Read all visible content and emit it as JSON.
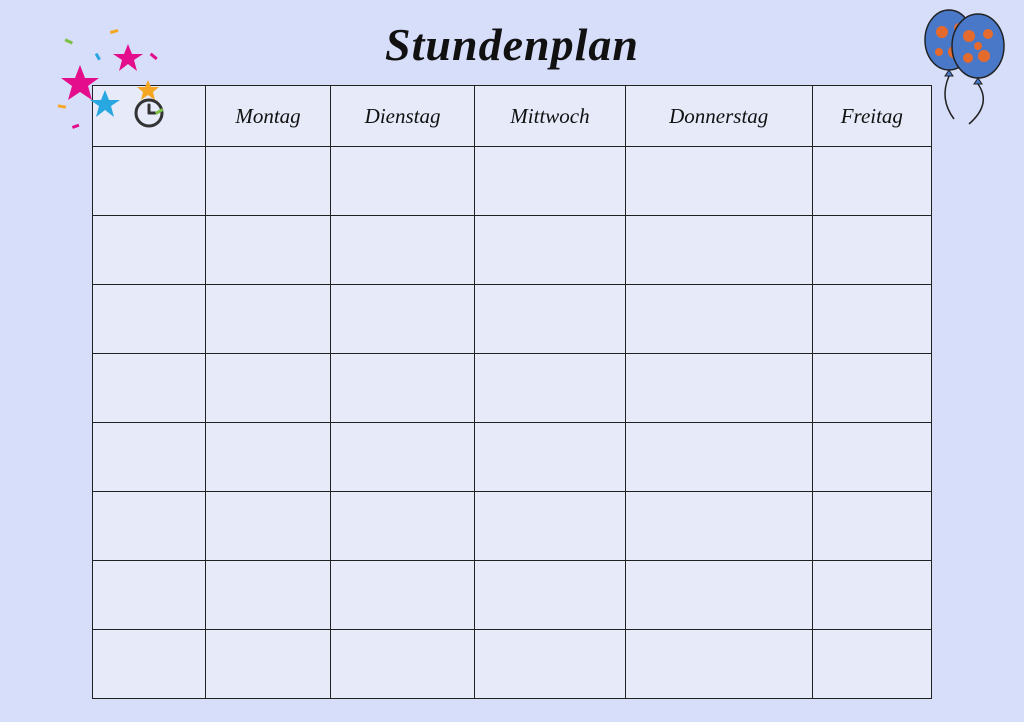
{
  "title": "Stundenplan",
  "header": {
    "time_icon": "clock-icon",
    "days": [
      "Montag",
      "Dienstag",
      "Mittwoch",
      "Donnerstag",
      "Freitag"
    ]
  },
  "rows": [
    {
      "time": "",
      "montag": "",
      "dienstag": "",
      "mittwoch": "",
      "donnerstag": "",
      "freitag": ""
    },
    {
      "time": "",
      "montag": "",
      "dienstag": "",
      "mittwoch": "",
      "donnerstag": "",
      "freitag": ""
    },
    {
      "time": "",
      "montag": "",
      "dienstag": "",
      "mittwoch": "",
      "donnerstag": "",
      "freitag": ""
    },
    {
      "time": "",
      "montag": "",
      "dienstag": "",
      "mittwoch": "",
      "donnerstag": "",
      "freitag": ""
    },
    {
      "time": "",
      "montag": "",
      "dienstag": "",
      "mittwoch": "",
      "donnerstag": "",
      "freitag": ""
    },
    {
      "time": "",
      "montag": "",
      "dienstag": "",
      "mittwoch": "",
      "donnerstag": "",
      "freitag": ""
    },
    {
      "time": "",
      "montag": "",
      "dienstag": "",
      "mittwoch": "",
      "donnerstag": "",
      "freitag": ""
    },
    {
      "time": "",
      "montag": "",
      "dienstag": "",
      "mittwoch": "",
      "donnerstag": "",
      "freitag": ""
    }
  ],
  "decorations": {
    "left": "stars-confetti",
    "right": "balloons"
  }
}
